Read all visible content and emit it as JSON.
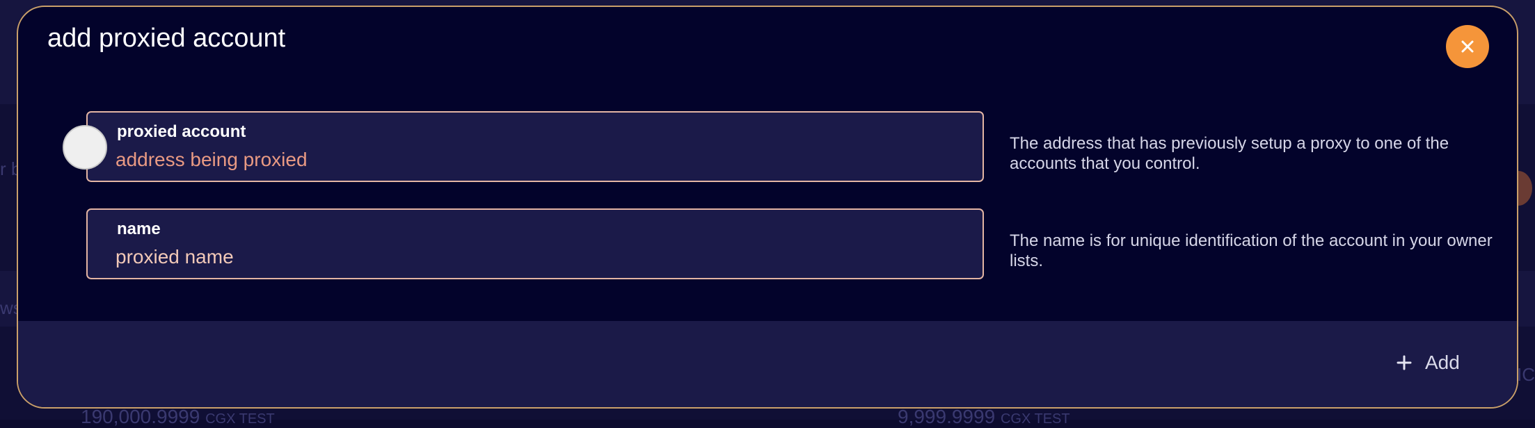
{
  "background": {
    "text_left_1": "r b",
    "text_left_2": "wsc",
    "text_right": "IC",
    "amount_left": "190,000",
    "amount_left_dec": ".9999",
    "amount_left_unit": "CGX TEST",
    "amount_right": "9,999",
    "amount_right_dec": ".9999",
    "amount_right_unit": "CGX TEST"
  },
  "modal": {
    "title": "add proxied account",
    "close_icon": "close-icon",
    "fields": [
      {
        "label": "proxied account",
        "placeholder": "address being proxied",
        "value": "",
        "help": "The address that has previously setup a proxy to one of the accounts that you control."
      },
      {
        "label": "name",
        "placeholder": "proxied name",
        "value": "",
        "help": "The name is for unique identification of the account in your owner lists."
      }
    ],
    "add_button": {
      "icon": "plus-icon",
      "label": "Add"
    }
  },
  "colors": {
    "accent": "#f5953a",
    "border": "#caa06a",
    "modal_bg": "#03032b",
    "field_bg": "#1b1a49"
  }
}
